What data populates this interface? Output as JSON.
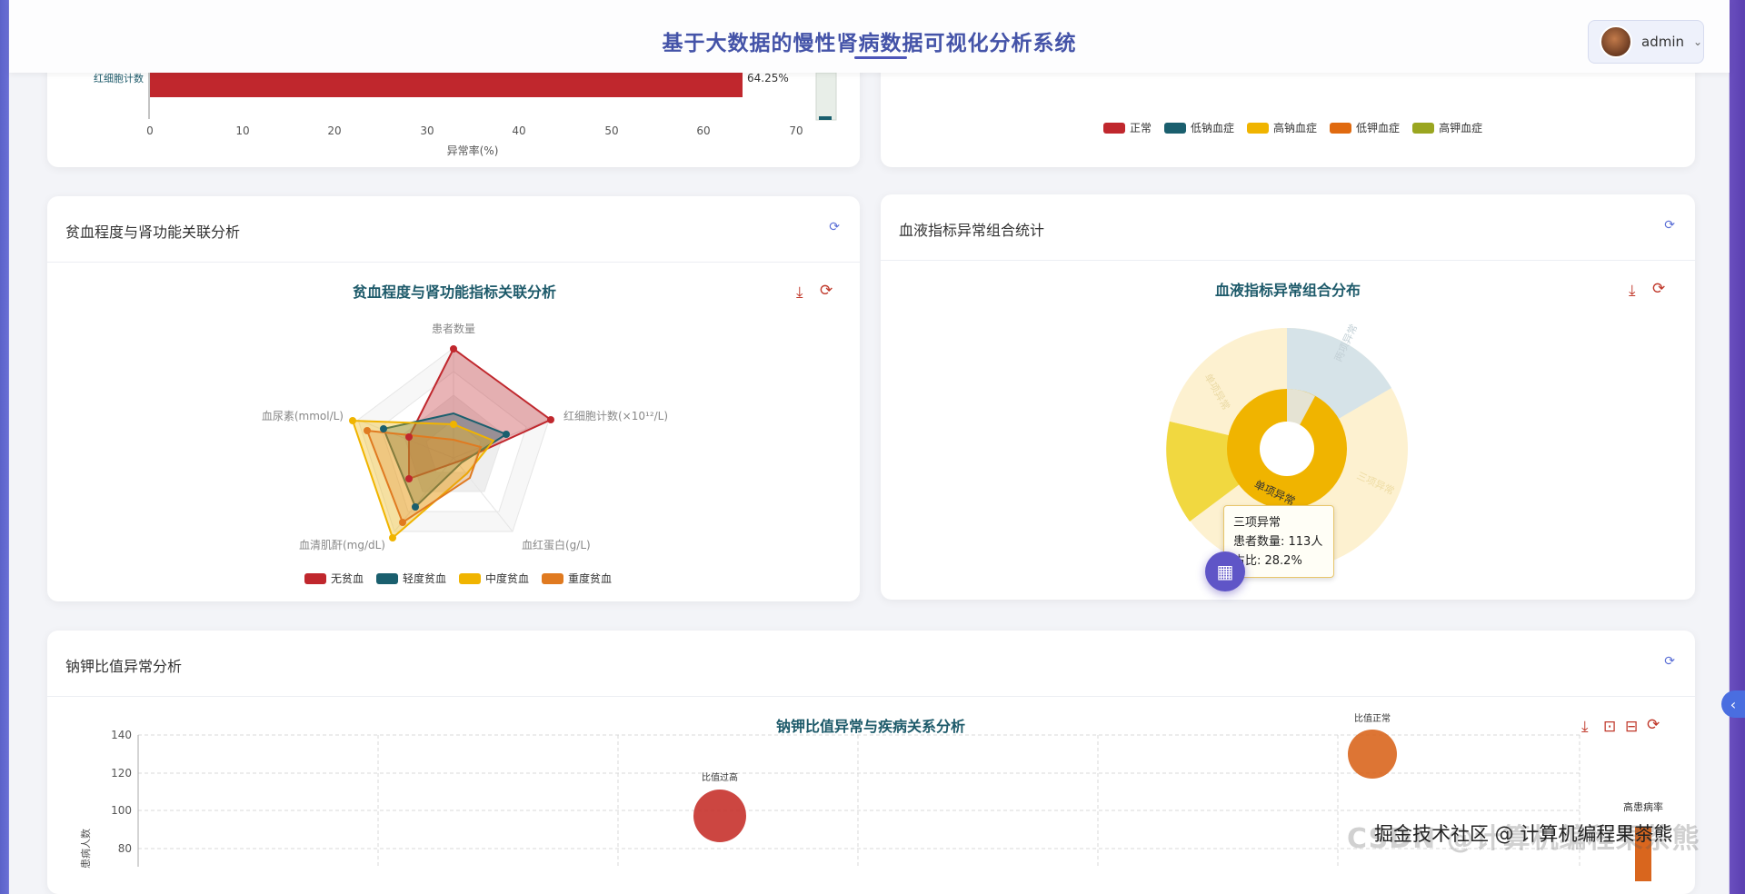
{
  "header": {
    "title": "基于大数据的慢性肾病数据可视化分析系统",
    "username": "admin"
  },
  "top_left_chart": {
    "category_label": "红细胞计数",
    "value_label": "64.25%",
    "axis_ticks": [
      "0",
      "10",
      "20",
      "30",
      "40",
      "50",
      "60",
      "70"
    ],
    "xlabel": "异常率(%)"
  },
  "top_right_legend": [
    {
      "label": "正常",
      "color": "#c0272d"
    },
    {
      "label": "低钠血症",
      "color": "#1a5f6e"
    },
    {
      "label": "高钠血症",
      "color": "#f0b400"
    },
    {
      "label": "低钾血症",
      "color": "#e06a10"
    },
    {
      "label": "高钾血症",
      "color": "#9aa620"
    }
  ],
  "anemia_card": {
    "title": "贫血程度与肾功能关联分析",
    "chart_title": "贫血程度与肾功能指标关联分析",
    "indicators": [
      "患者数量",
      "红细胞计数(×10¹²/L)",
      "血红蛋白(g/L)",
      "血清肌酐(mg/dL)",
      "血尿素(mmol/L)"
    ],
    "legend": [
      {
        "label": "无贫血",
        "color": "#c0272d"
      },
      {
        "label": "轻度贫血",
        "color": "#1a5f6e"
      },
      {
        "label": "中度贫血",
        "color": "#f0b400"
      },
      {
        "label": "重度贫血",
        "color": "#e07a20"
      }
    ]
  },
  "blood_card": {
    "title": "血液指标异常组合统计",
    "chart_title": "血液指标异常组合分布",
    "inner_label": "单项异常",
    "outer_labels": [
      "单项异常",
      "两项异常",
      "三项异常"
    ],
    "tooltip": {
      "name": "三项异常",
      "count_line": "患者数量: 113人",
      "ratio_line": "占比: 28.2%"
    }
  },
  "nak_card": {
    "title": "钠钾比值异常分析",
    "chart_title": "钠钾比值异常与疾病关系分析",
    "ylabel": "患病人数",
    "y_ticks": [
      "140",
      "120",
      "100",
      "80"
    ],
    "bubbles": [
      {
        "label": "比值过高"
      },
      {
        "label": "比值正常"
      },
      {
        "label": "高患病率"
      }
    ]
  },
  "watermark": "掘金技术社区 @ 计算机编程果茶熊",
  "watermark_bg": "CSDN @计算机编程果茶熊"
}
